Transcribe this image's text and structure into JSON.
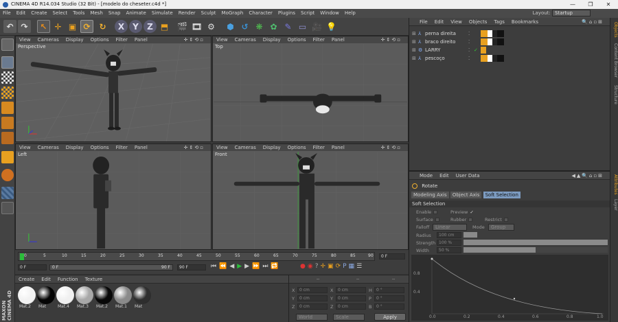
{
  "window": {
    "title": "CINEMA 4D R14.034 Studio (32 Bit) - [modelo do cheseter.c4d *]",
    "min": "—",
    "max": "❐",
    "close": "✕"
  },
  "menu": [
    "File",
    "Edit",
    "Create",
    "Select",
    "Tools",
    "Mesh",
    "Snap",
    "Animate",
    "Simulate",
    "Render",
    "Sculpt",
    "MoGraph",
    "Character",
    "Plugins",
    "Script",
    "Window",
    "Help"
  ],
  "layout": {
    "label": "Layout:",
    "value": "Startup"
  },
  "toolbar_icons": [
    "undo-icon",
    "redo-icon",
    "live-selection-icon",
    "move-icon",
    "scale-icon",
    "rotate-icon",
    "recent-tool-icon",
    "x-axis-icon",
    "y-axis-icon",
    "z-axis-icon",
    "coordinate-system-icon",
    "render-view-icon",
    "render-picture-viewer-icon",
    "render-settings-icon",
    "cube-icon",
    "bend-icon",
    "subdivision-icon",
    "array-icon",
    "spline-pen-icon",
    "floor-icon",
    "camera-icon",
    "light-icon"
  ],
  "toolbar_axes": [
    "X",
    "Y",
    "Z"
  ],
  "viewport_menu": [
    "View",
    "Cameras",
    "Display",
    "Options",
    "Filter",
    "Panel"
  ],
  "viewports": [
    {
      "label": "Perspective"
    },
    {
      "label": "Top"
    },
    {
      "label": "Left"
    },
    {
      "label": "Front"
    }
  ],
  "timeline": {
    "ticks": [
      "0",
      "5",
      "10",
      "15",
      "20",
      "25",
      "30",
      "35",
      "40",
      "45",
      "50",
      "55",
      "60",
      "65",
      "70",
      "75",
      "80",
      "85",
      "90"
    ],
    "current_frame": "0 F",
    "start": "0 F",
    "min": "0 F",
    "max": "90 F",
    "end": "90 F"
  },
  "materials": {
    "menu": [
      "Create",
      "Edit",
      "Function",
      "Texture"
    ],
    "items": [
      {
        "name": "Mat.2",
        "color": "#f2f2f2"
      },
      {
        "name": "Mat",
        "color": "#050505"
      },
      {
        "name": "Mat.4",
        "color": "#f0f0f0"
      },
      {
        "name": "Mat.3",
        "color": "#a8a8a8"
      },
      {
        "name": "Mat.2",
        "color": "#080808"
      },
      {
        "name": "Mat.1",
        "color": "#8a8a8a"
      },
      {
        "name": "Mat",
        "color": "#2e2e2e"
      }
    ]
  },
  "coords": {
    "header": [
      "--",
      "--",
      "--"
    ],
    "rows": [
      {
        "a": "X",
        "av": "0 cm",
        "b": "X",
        "bv": "0 cm",
        "c": "H",
        "cv": "0 °"
      },
      {
        "a": "Y",
        "av": "0 cm",
        "b": "Y",
        "bv": "0 cm",
        "c": "P",
        "cv": "0 °"
      },
      {
        "a": "Z",
        "av": "0 cm",
        "b": "Z",
        "bv": "0 cm",
        "c": "B",
        "cv": "0 °"
      }
    ],
    "mode1": "World",
    "mode2": "Scale",
    "apply": "Apply"
  },
  "objects": {
    "menu": [
      "File",
      "Edit",
      "View",
      "Objects",
      "Tags",
      "Bookmarks"
    ],
    "items": [
      {
        "name": "perna direita"
      },
      {
        "name": "braco direito"
      },
      {
        "name": "LARRY"
      },
      {
        "name": "pescoço"
      }
    ]
  },
  "attributes": {
    "menu": [
      "Mode",
      "Edit",
      "User Data"
    ],
    "tool": "Rotate",
    "tabs": [
      "Modeling Axis",
      "Object Axis",
      "Soft Selection"
    ],
    "active_tab": "Soft Selection",
    "section": "Soft Selection",
    "enable": "Enable",
    "preview": "Preview",
    "surface": "Surface",
    "rubber": "Rubber",
    "restrict": "Restrict",
    "falloff_label": "Falloff",
    "falloff_value": "Linear",
    "mode_label": "Mode",
    "mode_value": "Group",
    "radius_label": "Radius",
    "radius_value": "100 cm",
    "strength_label": "Strength",
    "strength_value": "100 %",
    "width_label": "Width",
    "width_value": "50 %",
    "strength_level": 1.0,
    "width_level": 0.5,
    "graph_y": [
      "0.8",
      "0.4"
    ],
    "graph_x": [
      "0.0",
      "0.2",
      "0.4",
      "0.6",
      "0.8",
      "1.0"
    ]
  },
  "right_tabs": [
    "Objects",
    "Content Browser",
    "Structure",
    "Attributes",
    "Layer"
  ],
  "brand": {
    "line1": "MAXON",
    "line2": "CINEMA 4D"
  }
}
